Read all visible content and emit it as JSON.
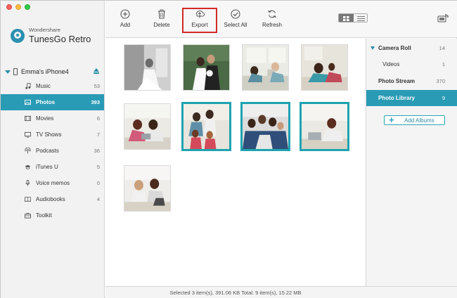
{
  "app": {
    "brand_small": "Wondershare",
    "brand_name": "TunesGo Retro"
  },
  "device": {
    "name": "Emma's iPhone4"
  },
  "sidebar": {
    "items": [
      {
        "label": "Music",
        "count": "53",
        "icon": "music-note-icon"
      },
      {
        "label": "Photos",
        "count": "393",
        "icon": "photo-icon",
        "active": true
      },
      {
        "label": "Movies",
        "count": "6",
        "icon": "film-icon"
      },
      {
        "label": "TV Shows",
        "count": "7",
        "icon": "tv-icon"
      },
      {
        "label": "Podcasts",
        "count": "36",
        "icon": "podcast-icon"
      },
      {
        "label": "iTunes U",
        "count": "5",
        "icon": "graduation-cap-icon"
      },
      {
        "label": "Voice memos",
        "count": "0",
        "icon": "microphone-icon"
      },
      {
        "label": "Audiobooks",
        "count": "4",
        "icon": "book-icon"
      },
      {
        "label": "Toolkit",
        "count": "",
        "icon": "toolkit-icon"
      }
    ]
  },
  "toolbar": {
    "add_label": "Add",
    "delete_label": "Delete",
    "export_label": "Export",
    "select_all_label": "Select All",
    "refresh_label": "Refresh"
  },
  "photos": [
    {
      "id": "photo-1",
      "selected": false
    },
    {
      "id": "photo-2",
      "selected": false
    },
    {
      "id": "photo-3",
      "selected": false
    },
    {
      "id": "photo-4",
      "selected": false
    },
    {
      "id": "photo-5",
      "selected": false
    },
    {
      "id": "photo-6",
      "selected": true
    },
    {
      "id": "photo-7",
      "selected": true
    },
    {
      "id": "photo-8",
      "selected": true
    },
    {
      "id": "photo-9",
      "selected": false
    }
  ],
  "albums": {
    "camera_roll_label": "Camera Roll",
    "camera_roll_count": "14",
    "videos_label": "Videos",
    "videos_count": "1",
    "photo_stream_label": "Photo Stream",
    "photo_stream_count": "370",
    "photo_library_label": "Photo Library",
    "photo_library_count": "9",
    "add_albums_label": "Add Albums"
  },
  "status": {
    "text": "Selected 3 item(s), 391.06 KB   Total: 9 item(s), 15.22 MB"
  },
  "colors": {
    "accent": "#2a9bb5",
    "selection_border": "#1fa3b0",
    "export_highlight": "#d02a2a"
  }
}
